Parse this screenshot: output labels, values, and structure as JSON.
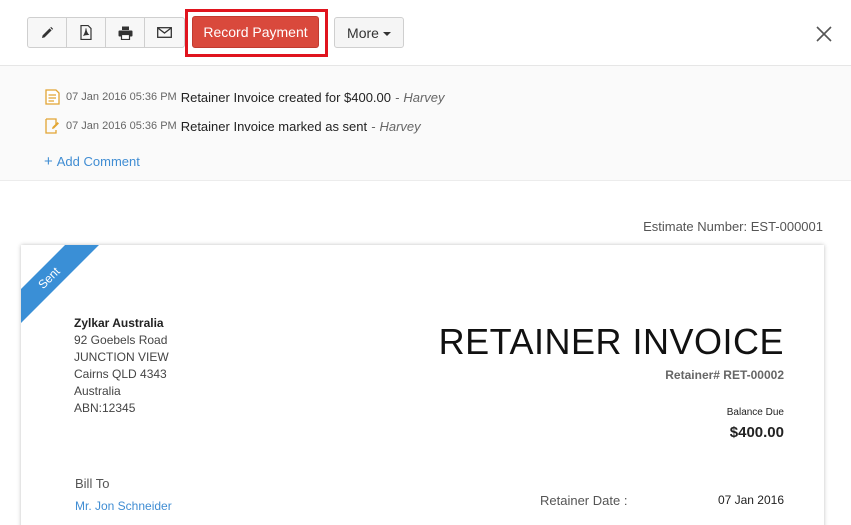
{
  "toolbar": {
    "icons": [
      "pencil-icon",
      "pdf-icon",
      "print-icon",
      "mail-icon"
    ],
    "record_payment_label": "Record Payment",
    "more_label": "More",
    "close_icon": "close-icon",
    "highlight_color": "#e0141e",
    "record_color": "#d9493c"
  },
  "activity": {
    "items": [
      {
        "time": "07 Jan 2016 05:36 PM",
        "text": "Retainer Invoice created for $400.00",
        "sep": "-",
        "user": "Harvey"
      },
      {
        "time": "07 Jan 2016 05:36 PM",
        "text": "Retainer Invoice marked as sent",
        "sep": "-",
        "user": "Harvey"
      }
    ],
    "add_comment": "Add Comment"
  },
  "document": {
    "estimate_number": "Estimate Number: EST-000001",
    "status_ribbon": "Sent",
    "org": {
      "name": "Zylkar Australia",
      "lines": [
        "92 Goebels Road",
        "JUNCTION VIEW",
        "Cairns QLD 4343",
        "Australia",
        "ABN:12345"
      ]
    },
    "title": "RETAINER INVOICE",
    "retainer_number": "Retainer# RET-00002",
    "balance_label": "Balance Due",
    "balance_value": "$400.00",
    "bill_to_label": "Bill To",
    "bill_to_name": "Mr. Jon Schneider",
    "retainer_date_label": "Retainer Date :",
    "retainer_date_value": "07 Jan 2016",
    "ribbon_color": "#3a8fd6",
    "link_color": "#408dd3"
  }
}
